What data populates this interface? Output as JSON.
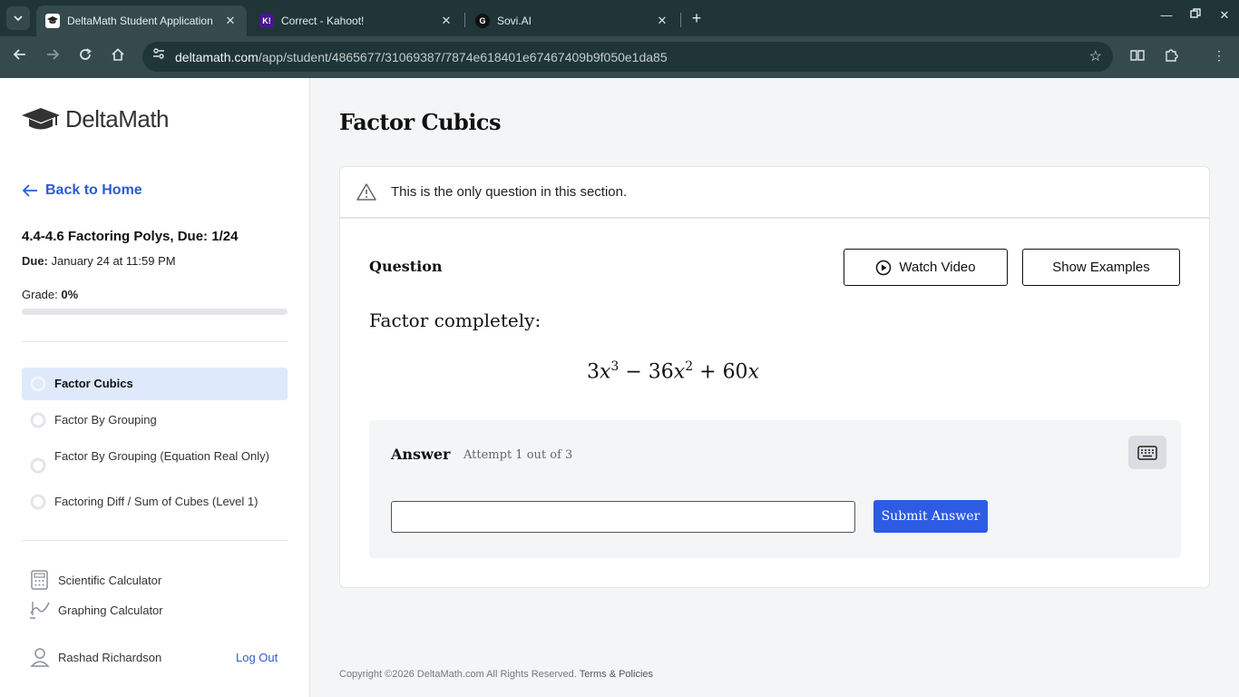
{
  "browser": {
    "tabs": [
      {
        "title": "DeltaMath Student Application",
        "active": true
      },
      {
        "title": "Correct - Kahoot!",
        "active": false
      },
      {
        "title": "Sovi.AI",
        "active": false
      }
    ],
    "url_host": "deltamath.com",
    "url_path": "/app/student/4865677/31069387/7874e618401e67467409b9f050e1da85"
  },
  "sidebar": {
    "logo_text": "DeltaMath",
    "back_label": "Back to Home",
    "assignment_title": "4.4-4.6 Factoring Polys, Due: 1/24",
    "due_label": "Due:",
    "due_value": "January 24 at 11:59 PM",
    "grade_label": "Grade:",
    "grade_value": "0%",
    "grade_fraction": 0,
    "problems": [
      {
        "label": "Factor Cubics",
        "active": true
      },
      {
        "label": "Factor By Grouping",
        "active": false
      },
      {
        "label": "Factor By Grouping (Equation Real Only)",
        "active": false
      },
      {
        "label": "Factoring Diff / Sum of Cubes (Level 1)",
        "active": false
      }
    ],
    "tools": {
      "scientific": "Scientific Calculator",
      "graphing": "Graphing Calculator"
    },
    "user_name": "Rashad Richardson",
    "logout": "Log Out"
  },
  "main": {
    "title": "Factor Cubics",
    "notice": "This is the only question in this section.",
    "question_label": "Question",
    "watch_video": "Watch Video",
    "show_examples": "Show Examples",
    "prompt": "Factor completely:",
    "expression": {
      "a": "3",
      "b": "36",
      "c": "60",
      "exp3": "3",
      "exp2": "2",
      "minus": "−",
      "plus": "+",
      "var": "x"
    },
    "answer_label": "Answer",
    "attempt": "Attempt 1 out of 3",
    "answer_value": "",
    "submit": "Submit Answer",
    "footer_copyright": "Copyright ©2026 DeltaMath.com All Rights Reserved.",
    "footer_terms": "Terms & Policies"
  },
  "colors": {
    "accent": "#2e5bd4",
    "submit": "#2d5be3",
    "active_item_bg": "#dee9fb"
  }
}
